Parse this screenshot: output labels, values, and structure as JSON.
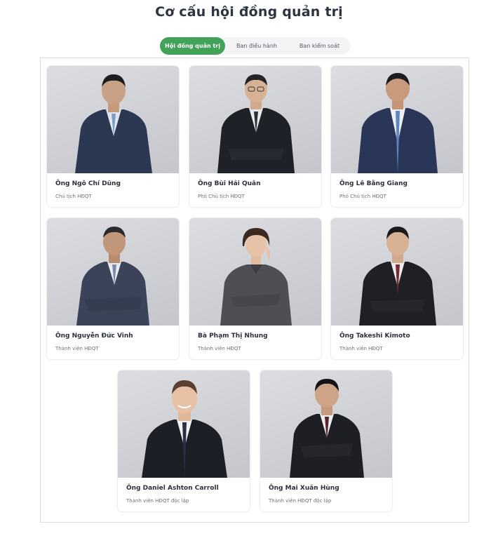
{
  "page": {
    "title": "Cơ cấu hội đồng quản trị"
  },
  "tabs": [
    {
      "label": "Hội đồng quản trị",
      "active": true
    },
    {
      "label": "Ban điều hành",
      "active": false
    },
    {
      "label": "Ban kiểm soát",
      "active": false
    }
  ],
  "colors": {
    "accent": "#43a25a",
    "border": "#d9dbe0"
  },
  "members": [
    {
      "name": "Ông Ngô Chí Dũng",
      "role": "Chủ tịch HĐQT"
    },
    {
      "name": "Ông Bùi Hải Quân",
      "role": "Phó Chủ tịch HĐQT"
    },
    {
      "name": "Ông Lê Bằng Giang",
      "role": "Phó Chủ tịch HĐQT"
    },
    {
      "name": "Ông Nguyễn Đức Vinh",
      "role": "Thành viên HĐQT"
    },
    {
      "name": "Bà Phạm Thị Nhung",
      "role": "Thành viên HĐQT"
    },
    {
      "name": "Ông Takeshi Kimoto",
      "role": "Thành viên HĐQT"
    },
    {
      "name": "Ông Daniel Ashton Carroll",
      "role": "Thành viên HĐQT độc lập"
    },
    {
      "name": "Ông Mai Xuân Hùng",
      "role": "Thành viên HĐQT độc lập"
    }
  ]
}
